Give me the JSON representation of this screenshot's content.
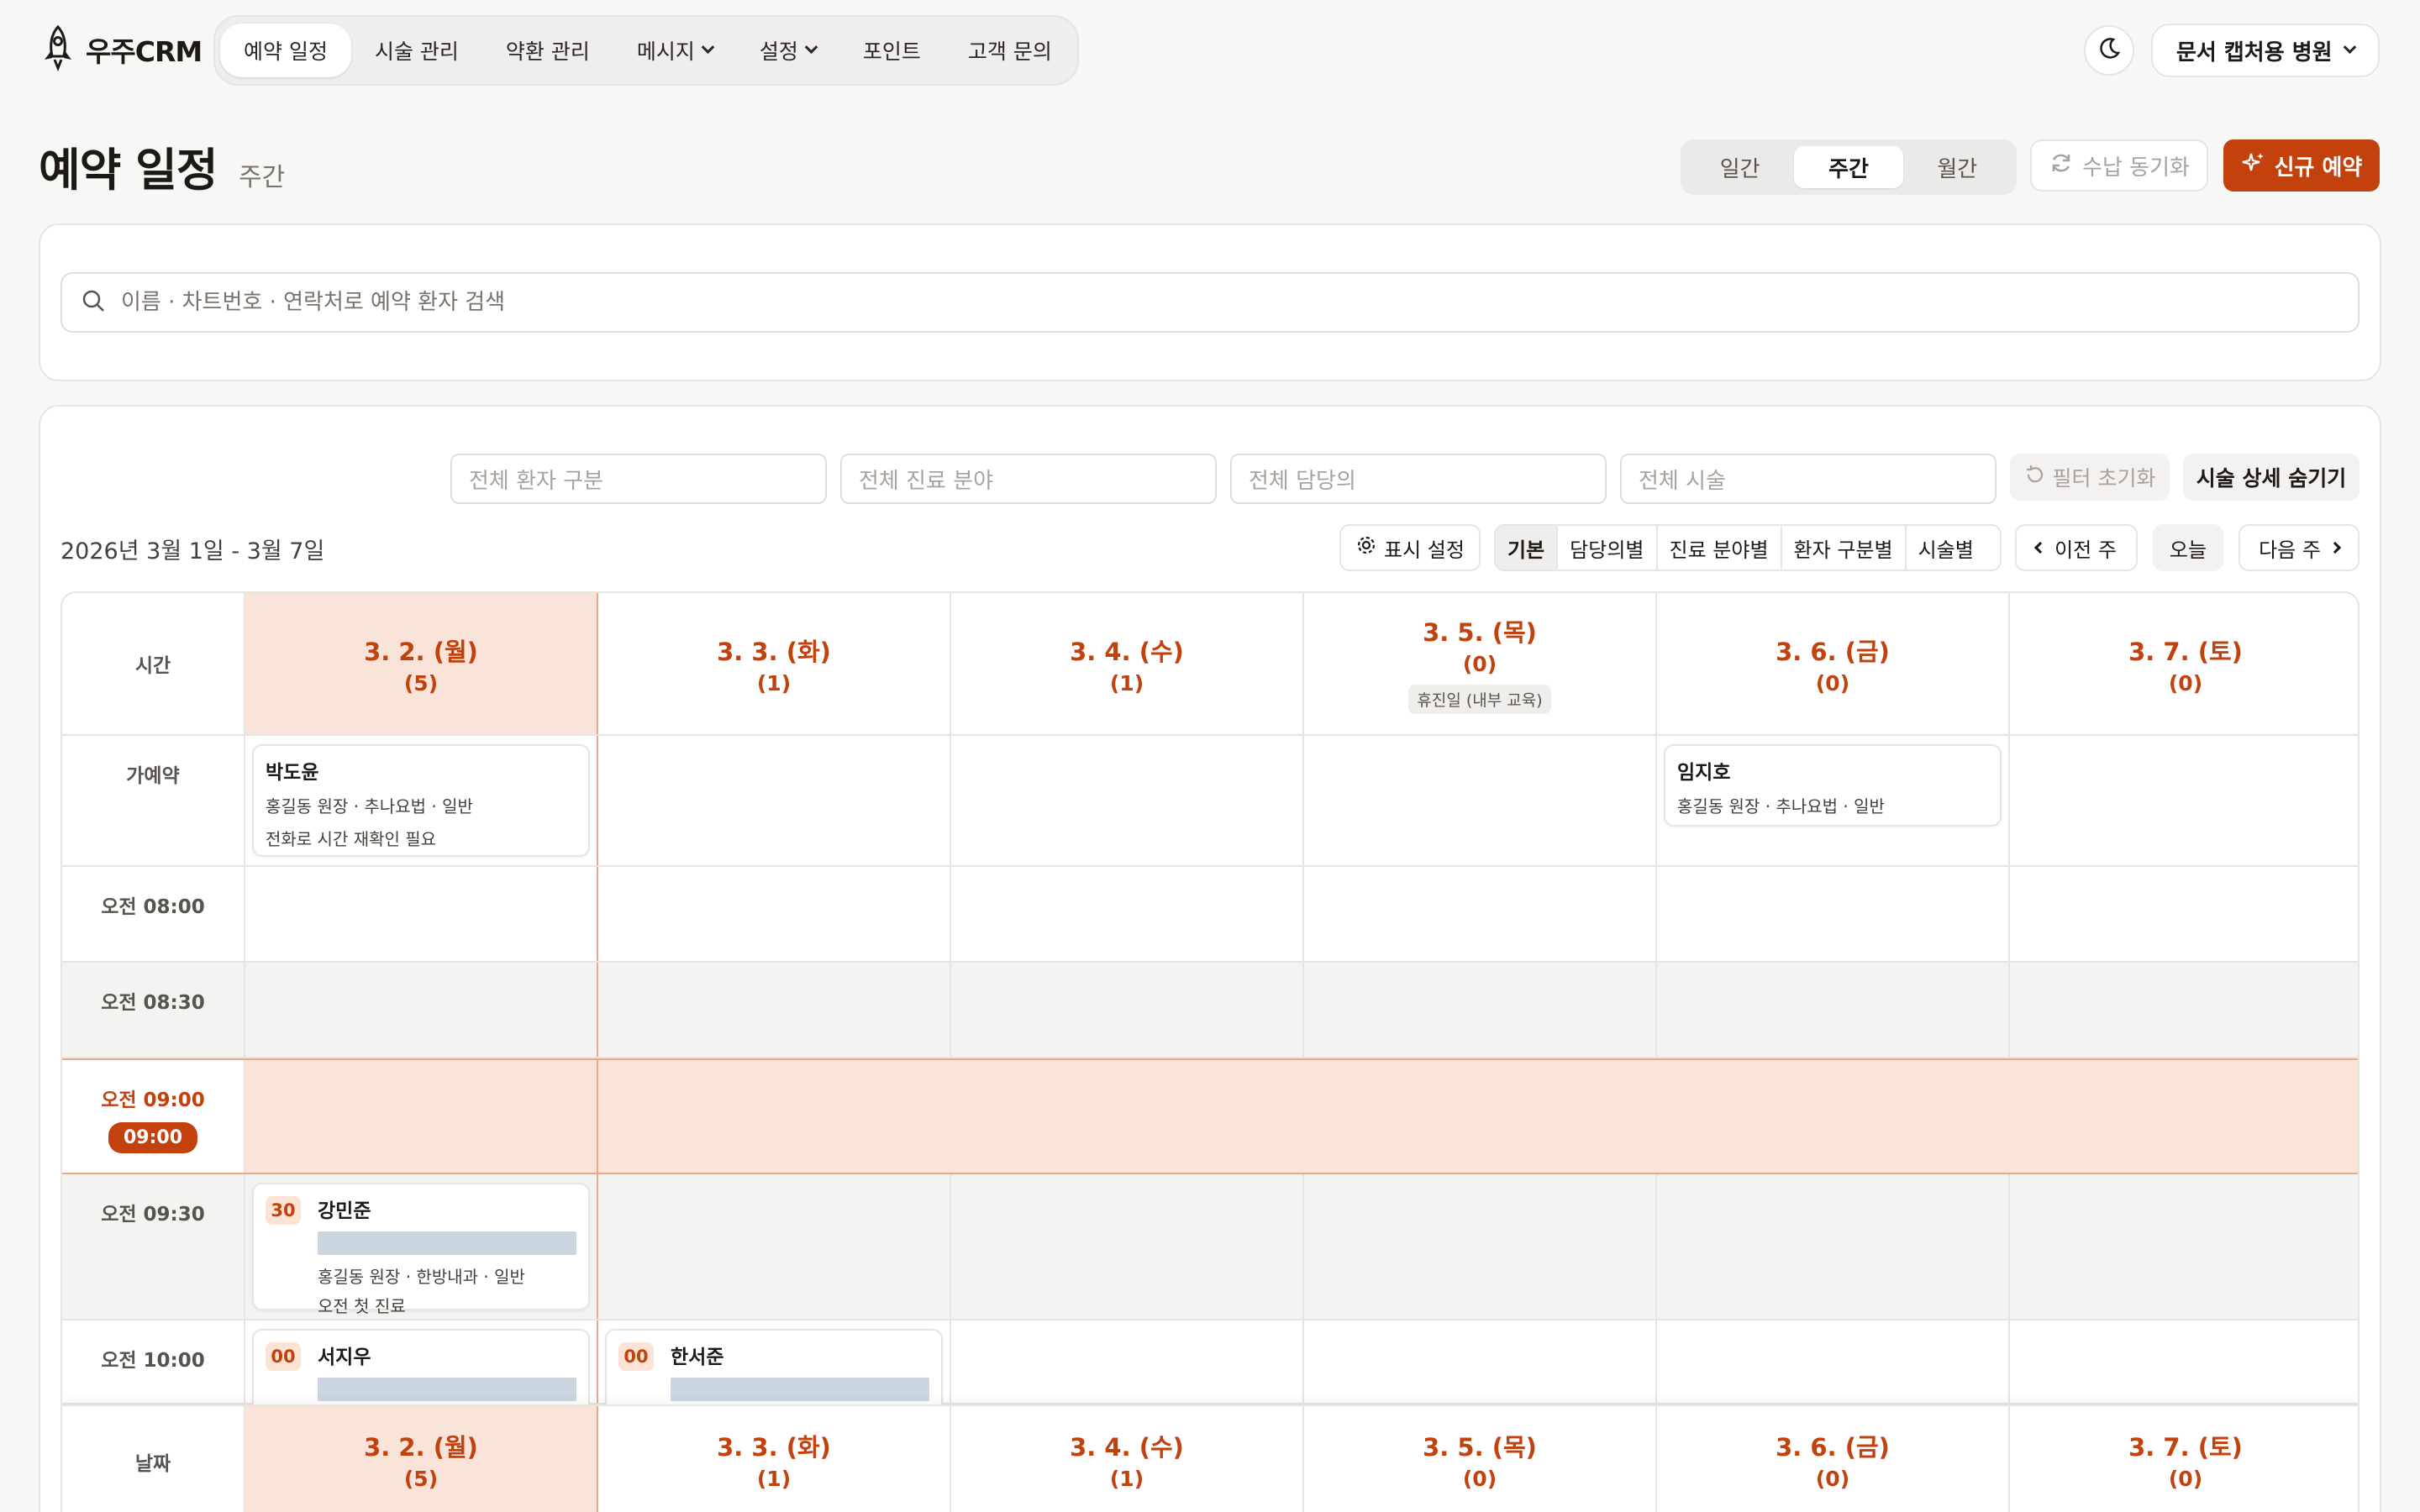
{
  "app": {
    "logo_text": "우주CRM"
  },
  "nav": {
    "items": [
      {
        "label": "예약 일정",
        "active": true,
        "dropdown": false
      },
      {
        "label": "시술 관리",
        "active": false,
        "dropdown": false
      },
      {
        "label": "약환 관리",
        "active": false,
        "dropdown": false
      },
      {
        "label": "메시지",
        "active": false,
        "dropdown": true
      },
      {
        "label": "설정",
        "active": false,
        "dropdown": true
      },
      {
        "label": "포인트",
        "active": false,
        "dropdown": false
      },
      {
        "label": "고객 문의",
        "active": false,
        "dropdown": false
      }
    ],
    "theme_icon": "moon-icon",
    "clinic_label": "문서 캡처용 병원"
  },
  "header": {
    "title": "예약 일정",
    "subtitle": "주간",
    "views": [
      {
        "label": "일간",
        "active": false
      },
      {
        "label": "주간",
        "active": true
      },
      {
        "label": "월간",
        "active": false
      }
    ],
    "sync_label": "수납 동기화",
    "new_label": "신규 예약"
  },
  "search": {
    "placeholder": "이름 · 차트번호 · 연락처로 예약 환자 검색"
  },
  "filters": {
    "patient_type": "전체 환자 구분",
    "department": "전체 진료 분야",
    "doctor": "전체 담당의",
    "procedure": "전체 시술",
    "reset_label": "필터 초기화",
    "hide_detail_label": "시술 상세 숨기기"
  },
  "toolbar": {
    "range": "2026년 3월 1일 - 3월 7일",
    "display_settings": "표시 설정",
    "groupings": [
      {
        "label": "기본",
        "active": true
      },
      {
        "label": "담당의별",
        "active": false
      },
      {
        "label": "진료 분야별",
        "active": false
      },
      {
        "label": "환자 구분별",
        "active": false
      },
      {
        "label": "시술별",
        "active": false
      }
    ],
    "prev_label": "이전 주",
    "today_label": "오늘",
    "next_label": "다음 주"
  },
  "calendar": {
    "time_header": "시간",
    "date_header": "날짜",
    "tentative_label": "가예약",
    "days": [
      {
        "date": "3. 2. (월)",
        "count": "(5)",
        "highlight": true,
        "note": ""
      },
      {
        "date": "3. 3. (화)",
        "count": "(1)",
        "highlight": false,
        "note": ""
      },
      {
        "date": "3. 4. (수)",
        "count": "(1)",
        "highlight": false,
        "note": ""
      },
      {
        "date": "3. 5. (목)",
        "count": "(0)",
        "highlight": false,
        "note": "휴진일 (내부 교육)"
      },
      {
        "date": "3. 6. (금)",
        "count": "(0)",
        "highlight": false,
        "note": ""
      },
      {
        "date": "3. 7. (토)",
        "count": "(0)",
        "highlight": false,
        "note": ""
      }
    ],
    "slots": [
      "오전 08:00",
      "오전 08:30",
      "오전 09:00",
      "오전 09:30",
      "오전 10:00"
    ],
    "now_badge": "09:00",
    "tentative": [
      {
        "day": 0,
        "name": "박도윤",
        "detail": "홍길동 원장 · 추나요법 · 일반",
        "memo": "전화로 시간 재확인 필요"
      },
      {
        "day": 4,
        "name": "임지호",
        "detail": "홍길동 원장 · 추나요법 · 일반",
        "memo": ""
      }
    ],
    "appointments": [
      {
        "day": 0,
        "slot": 3,
        "minute": "30",
        "name": "강민준",
        "detail": "홍길동 원장 · 한방내과 · 일반",
        "memo": "오전 첫 진료"
      },
      {
        "day": 0,
        "slot": 4,
        "minute": "00",
        "name": "서지우",
        "detail": "",
        "memo": ""
      },
      {
        "day": 1,
        "slot": 4,
        "minute": "00",
        "name": "한서준",
        "detail": "",
        "memo": ""
      }
    ]
  },
  "colors": {
    "accent": "#c2410c",
    "highlight_bg": "#fae3d9",
    "redaction": "#cbd5e1"
  }
}
